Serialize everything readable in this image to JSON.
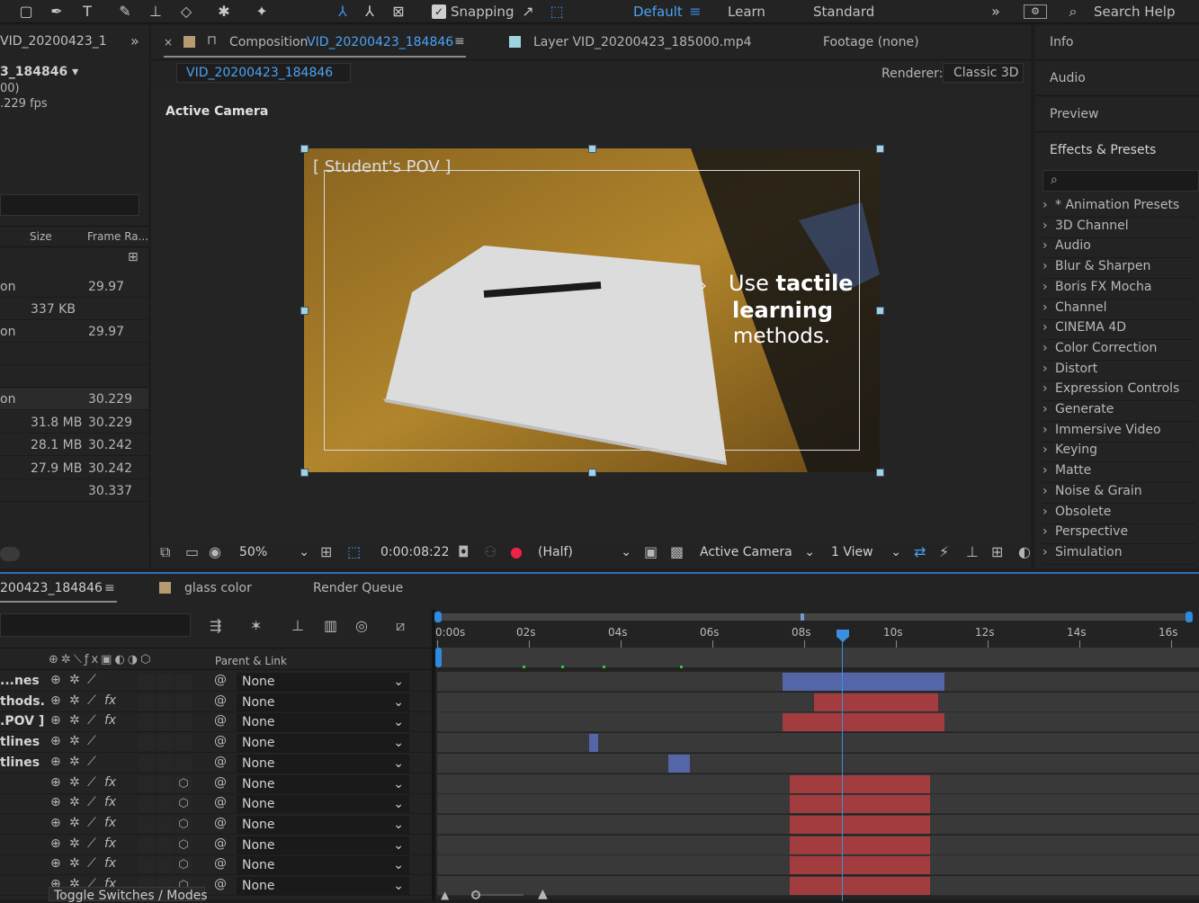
{
  "toolbar": {
    "snapping": "Snapping",
    "workspaces": [
      "Default",
      "Learn",
      "Standard"
    ],
    "search": "Search Help"
  },
  "project": {
    "name": "VID_20200423_1",
    "comp": "3_184846 ▾",
    "line2": "00)",
    "line3": ".229 fps",
    "col_size": "Size",
    "col_rate": "Frame Ra...",
    "rows": [
      {
        "name": "on",
        "size": "",
        "rate": "29.97"
      },
      {
        "name": "",
        "size": "337 KB",
        "rate": ""
      },
      {
        "name": "on",
        "size": "",
        "rate": "29.97"
      },
      {
        "name": "",
        "size": "",
        "rate": ""
      },
      {
        "name": "",
        "size": "",
        "rate": ""
      },
      {
        "name": "on",
        "size": "",
        "rate": "30.229"
      },
      {
        "name": "",
        "size": "31.8 MB",
        "rate": "30.229"
      },
      {
        "name": "",
        "size": "28.1 MB",
        "rate": "30.242"
      },
      {
        "name": "",
        "size": "27.9 MB",
        "rate": "30.242"
      },
      {
        "name": "",
        "size": "",
        "rate": "30.337"
      }
    ]
  },
  "comp_panel": {
    "tab_prefix": "Composition",
    "tab_name": "VID_20200423_184846",
    "layer_tab": "Layer VID_20200423_185000.mp4",
    "footage_tab": "Footage (none)",
    "breadcrumb": "VID_20200423_184846",
    "renderer_label": "Renderer:",
    "renderer_value": "Classic 3D",
    "view_label": "Active Camera"
  },
  "viewer": {
    "pov_text": "[ Student's POV ]",
    "line1_a": "Use",
    "line1_b": "tactile",
    "line2": "learning",
    "line3": "methods."
  },
  "viewer_controls": {
    "zoom": "50%",
    "timecode": "0:00:08:22",
    "resolution": "(Half)",
    "camera": "Active Camera",
    "views": "1 View"
  },
  "right_panel": {
    "tabs": [
      "Info",
      "Audio",
      "Preview",
      "Effects & Presets"
    ],
    "effects": [
      "* Animation Presets",
      "3D Channel",
      "Audio",
      "Blur & Sharpen",
      "Boris FX Mocha",
      "Channel",
      "CINEMA 4D",
      "Color Correction",
      "Distort",
      "Expression Controls",
      "Generate",
      "Immersive Video",
      "Keying",
      "Matte",
      "Noise & Grain",
      "Obsolete",
      "Perspective",
      "Simulation"
    ]
  },
  "timeline": {
    "tab_comp": "200423_184846",
    "tab_glass": "glass color",
    "tab_render": "Render Queue",
    "parent_header": "Parent & Link",
    "toggle": "Toggle Switches / Modes",
    "ruler": [
      "0:00s",
      "02s",
      "04s",
      "06s",
      "08s",
      "10s",
      "12s",
      "14s",
      "16s"
    ],
    "layers": [
      {
        "name": "...nes",
        "parent": "None"
      },
      {
        "name": "thods.",
        "parent": "None"
      },
      {
        "name": ".POV ]",
        "parent": "None"
      },
      {
        "name": "tlines",
        "parent": "None"
      },
      {
        "name": "tlines",
        "parent": "None"
      },
      {
        "name": "",
        "parent": "None"
      },
      {
        "name": "",
        "parent": "None"
      },
      {
        "name": "",
        "parent": "None"
      },
      {
        "name": "",
        "parent": "None"
      },
      {
        "name": "",
        "parent": "None"
      },
      {
        "name": "",
        "parent": "None"
      }
    ]
  },
  "colors": {
    "accent": "#4aa3f5",
    "bar_blue": "#5566a8",
    "bar_red": "#a23c3e"
  }
}
